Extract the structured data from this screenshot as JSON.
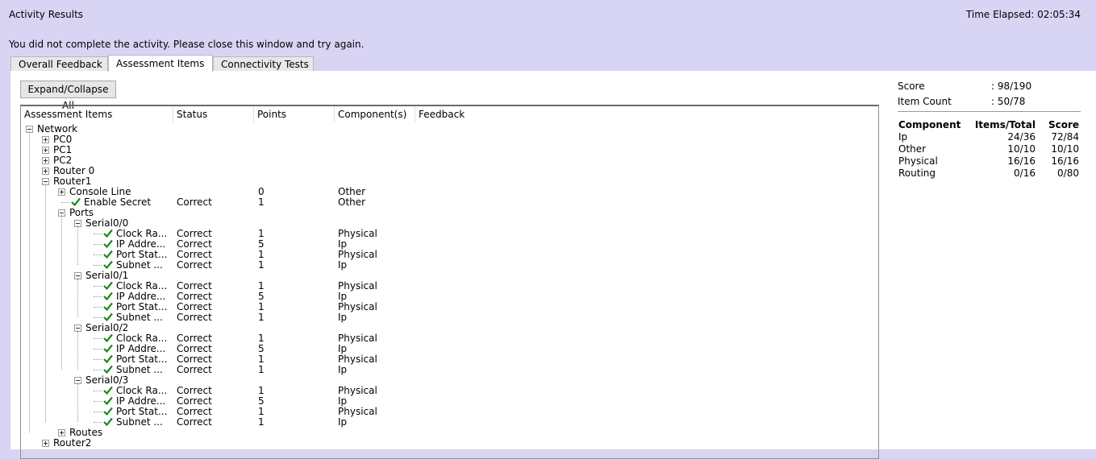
{
  "window": {
    "title": "Activity Results",
    "time_elapsed": "Time Elapsed: 02:05:34"
  },
  "message": "You did not complete the activity. Please close this window and try again.",
  "tabs": [
    {
      "label": "Overall Feedback",
      "active": false
    },
    {
      "label": "Assessment Items",
      "active": true
    },
    {
      "label": "Connectivity Tests",
      "active": false
    }
  ],
  "toolbar": {
    "expand_label": "Expand/Collapse All"
  },
  "columns": [
    "Assessment Items",
    "Status",
    "Points",
    "Component(s)",
    "Feedback"
  ],
  "tree": [
    {
      "level": 0,
      "label": "Network",
      "toggle": "minus"
    },
    {
      "level": 1,
      "label": "PC0",
      "toggle": "plus"
    },
    {
      "level": 1,
      "label": "PC1",
      "toggle": "plus"
    },
    {
      "level": 1,
      "label": "PC2",
      "toggle": "plus"
    },
    {
      "level": 1,
      "label": "Router 0",
      "toggle": "plus"
    },
    {
      "level": 1,
      "label": "Router1",
      "toggle": "minus"
    },
    {
      "level": 2,
      "label": "Console Line",
      "toggle": "plus",
      "points": "0",
      "component": "Other"
    },
    {
      "level": 2,
      "label": "Enable Secret",
      "check": true,
      "status": "Correct",
      "points": "1",
      "component": "Other"
    },
    {
      "level": 2,
      "label": "Ports",
      "toggle": "minus"
    },
    {
      "level": 3,
      "label": "Serial0/0",
      "toggle": "minus"
    },
    {
      "level": 4,
      "label": "Clock Ra...",
      "check": true,
      "status": "Correct",
      "points": "1",
      "component": "Physical"
    },
    {
      "level": 4,
      "label": "IP Addre...",
      "check": true,
      "status": "Correct",
      "points": "5",
      "component": "Ip"
    },
    {
      "level": 4,
      "label": "Port Stat...",
      "check": true,
      "status": "Correct",
      "points": "1",
      "component": "Physical"
    },
    {
      "level": 4,
      "label": "Subnet ...",
      "check": true,
      "status": "Correct",
      "points": "1",
      "component": "Ip"
    },
    {
      "level": 3,
      "label": "Serial0/1",
      "toggle": "minus"
    },
    {
      "level": 4,
      "label": "Clock Ra...",
      "check": true,
      "status": "Correct",
      "points": "1",
      "component": "Physical"
    },
    {
      "level": 4,
      "label": "IP Addre...",
      "check": true,
      "status": "Correct",
      "points": "5",
      "component": "Ip"
    },
    {
      "level": 4,
      "label": "Port Stat...",
      "check": true,
      "status": "Correct",
      "points": "1",
      "component": "Physical"
    },
    {
      "level": 4,
      "label": "Subnet ...",
      "check": true,
      "status": "Correct",
      "points": "1",
      "component": "Ip"
    },
    {
      "level": 3,
      "label": "Serial0/2",
      "toggle": "minus"
    },
    {
      "level": 4,
      "label": "Clock Ra...",
      "check": true,
      "status": "Correct",
      "points": "1",
      "component": "Physical"
    },
    {
      "level": 4,
      "label": "IP Addre...",
      "check": true,
      "status": "Correct",
      "points": "5",
      "component": "Ip"
    },
    {
      "level": 4,
      "label": "Port Stat...",
      "check": true,
      "status": "Correct",
      "points": "1",
      "component": "Physical"
    },
    {
      "level": 4,
      "label": "Subnet ...",
      "check": true,
      "status": "Correct",
      "points": "1",
      "component": "Ip"
    },
    {
      "level": 3,
      "label": "Serial0/3",
      "toggle": "minus"
    },
    {
      "level": 4,
      "label": "Clock Ra...",
      "check": true,
      "status": "Correct",
      "points": "1",
      "component": "Physical"
    },
    {
      "level": 4,
      "label": "IP Addre...",
      "check": true,
      "status": "Correct",
      "points": "5",
      "component": "Ip"
    },
    {
      "level": 4,
      "label": "Port Stat...",
      "check": true,
      "status": "Correct",
      "points": "1",
      "component": "Physical"
    },
    {
      "level": 4,
      "label": "Subnet ...",
      "check": true,
      "status": "Correct",
      "points": "1",
      "component": "Ip"
    },
    {
      "level": 2,
      "label": "Routes",
      "toggle": "plus"
    },
    {
      "level": 1,
      "label": "Router2",
      "toggle": "plus"
    }
  ],
  "summary": {
    "score_label": "Score",
    "score_value": ": 98/190",
    "count_label": "Item Count",
    "count_value": ": 50/78"
  },
  "components": {
    "headers": [
      "Component",
      "Items/Total",
      "Score"
    ],
    "rows": [
      [
        "Ip",
        "24/36",
        "72/84"
      ],
      [
        "Other",
        "10/10",
        "10/10"
      ],
      [
        "Physical",
        "16/16",
        "16/16"
      ],
      [
        "Routing",
        "0/16",
        "0/80"
      ]
    ]
  },
  "colors": {
    "window_bg": "#d8d4f4",
    "panel_bg": "#ffffff",
    "check_green": "#1a8a1a"
  }
}
